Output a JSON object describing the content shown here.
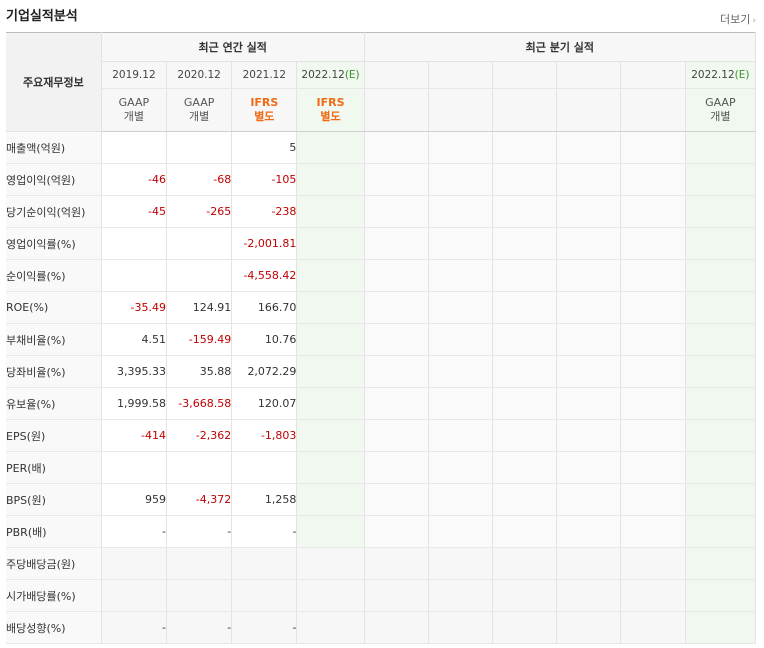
{
  "header": {
    "title": "기업실적분석",
    "more_label": "더보기",
    "more_arrow": "›"
  },
  "table": {
    "corner_label": "주요재무정보",
    "annual_header": "최근 연간 실적",
    "quarter_header": "최근 분기 실적",
    "annual_periods": [
      {
        "date": "2019.12",
        "std": "GAAP",
        "basis": "개별",
        "ifrs": false,
        "estimate": false
      },
      {
        "date": "2020.12",
        "std": "GAAP",
        "basis": "개별",
        "ifrs": false,
        "estimate": false
      },
      {
        "date": "2021.12",
        "std": "IFRS",
        "basis": "별도",
        "ifrs": true,
        "estimate": false
      },
      {
        "date": "2022.12",
        "est": "(E)",
        "std": "IFRS",
        "basis": "별도",
        "ifrs": true,
        "estimate": true
      }
    ],
    "quarter_last": {
      "date": "2022.12",
      "est": "(E)",
      "std": "GAAP",
      "basis": "개별"
    },
    "rows": [
      {
        "label": "매출액(억원)",
        "values": [
          "",
          "",
          "5",
          ""
        ],
        "neg": [
          false,
          false,
          false,
          false
        ]
      },
      {
        "label": "영업이익(억원)",
        "values": [
          "-46",
          "-68",
          "-105",
          ""
        ],
        "neg": [
          true,
          true,
          true,
          false
        ]
      },
      {
        "label": "당기순이익(억원)",
        "values": [
          "-45",
          "-265",
          "-238",
          ""
        ],
        "neg": [
          true,
          true,
          true,
          false
        ]
      },
      {
        "label": "영업이익률(%)",
        "values": [
          "",
          "",
          "-2,001.81",
          ""
        ],
        "neg": [
          false,
          false,
          true,
          false
        ]
      },
      {
        "label": "순이익률(%)",
        "values": [
          "",
          "",
          "-4,558.42",
          ""
        ],
        "neg": [
          false,
          false,
          true,
          false
        ]
      },
      {
        "label": "ROE(%)",
        "values": [
          "-35.49",
          "124.91",
          "166.70",
          ""
        ],
        "neg": [
          true,
          false,
          false,
          false
        ]
      },
      {
        "label": "부채비율(%)",
        "values": [
          "4.51",
          "-159.49",
          "10.76",
          ""
        ],
        "neg": [
          false,
          true,
          false,
          false
        ]
      },
      {
        "label": "당좌비율(%)",
        "values": [
          "3,395.33",
          "35.88",
          "2,072.29",
          ""
        ],
        "neg": [
          false,
          false,
          false,
          false
        ]
      },
      {
        "label": "유보율(%)",
        "values": [
          "1,999.58",
          "-3,668.58",
          "120.07",
          ""
        ],
        "neg": [
          false,
          true,
          false,
          false
        ]
      },
      {
        "label": "EPS(원)",
        "values": [
          "-414",
          "-2,362",
          "-1,803",
          ""
        ],
        "neg": [
          true,
          true,
          true,
          false
        ]
      },
      {
        "label": "PER(배)",
        "values": [
          "",
          "",
          "",
          ""
        ],
        "neg": [
          false,
          false,
          false,
          false
        ]
      },
      {
        "label": "BPS(원)",
        "values": [
          "959",
          "-4,372",
          "1,258",
          ""
        ],
        "neg": [
          false,
          true,
          false,
          false
        ]
      },
      {
        "label": "PBR(배)",
        "values": [
          "-",
          "-",
          "-",
          ""
        ],
        "neg": [
          false,
          false,
          false,
          false
        ]
      },
      {
        "label": "주당배당금(원)",
        "values": [
          "",
          "",
          "",
          ""
        ],
        "neg": [
          false,
          false,
          false,
          false
        ]
      },
      {
        "label": "시가배당률(%)",
        "values": [
          "",
          "",
          "",
          ""
        ],
        "neg": [
          false,
          false,
          false,
          false
        ]
      },
      {
        "label": "배당성향(%)",
        "values": [
          "-",
          "-",
          "-",
          ""
        ],
        "neg": [
          false,
          false,
          false,
          false
        ]
      }
    ]
  },
  "colors": {
    "negative": "#c00000",
    "ifrs": "#f06a14",
    "estimate_bg": "#f1f8ef"
  }
}
